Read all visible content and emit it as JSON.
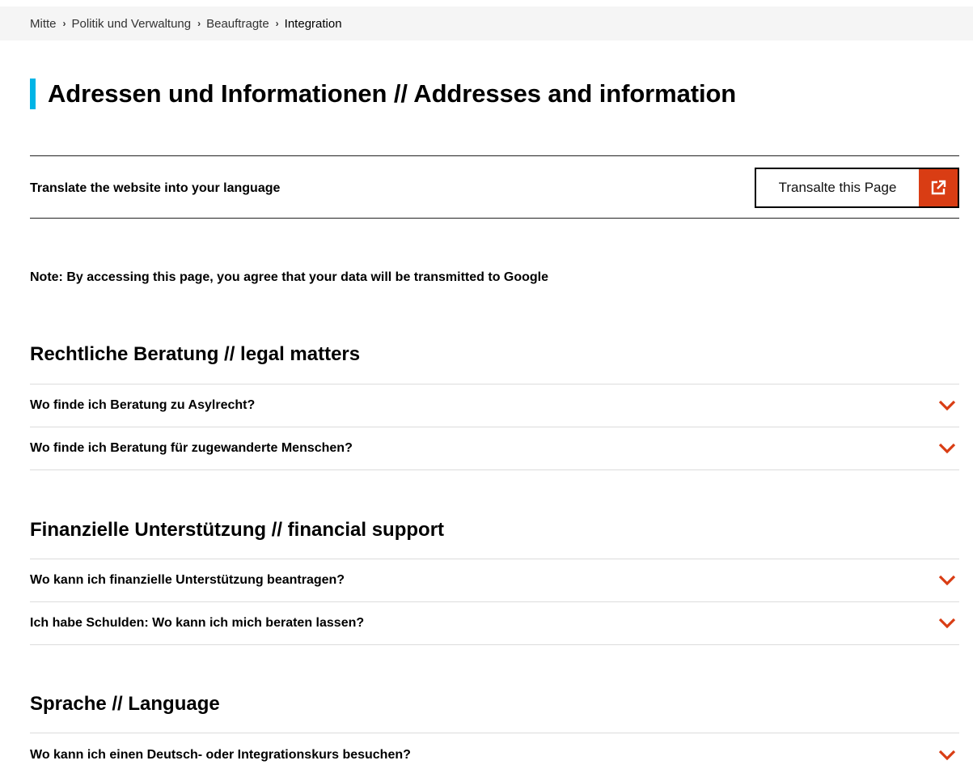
{
  "breadcrumb": {
    "items": [
      "Mitte",
      "Politik und Verwaltung",
      "Beauftragte"
    ],
    "current": "Integration",
    "separator": "›"
  },
  "page_title": "Adressen und Informationen // Addresses and information",
  "accent_color": "#00b4e6",
  "translate": {
    "text": "Translate the website into your language",
    "button_label": "Transalte this Page",
    "icon": "external-link-icon",
    "icon_color": "#d93d14"
  },
  "note": "Note: By accessing this page, you agree that your data will be transmitted to Google",
  "sections": [
    {
      "heading": "Rechtliche Beratung // legal matters",
      "items": [
        "Wo finde ich Beratung zu Asylrecht?",
        "Wo finde ich Beratung für zugewanderte Menschen?"
      ]
    },
    {
      "heading": "Finanzielle Unterstützung // financial support",
      "items": [
        "Wo kann ich finanzielle Unterstützung beantragen?",
        "Ich habe Schulden: Wo kann ich mich beraten lassen?"
      ]
    },
    {
      "heading": "Sprache // Language",
      "items": [
        "Wo kann ich einen Deutsch- oder Integrationskurs besuchen?"
      ]
    }
  ],
  "chevron_color": "#d93d14",
  "chevron_icon": "chevron-down-icon"
}
